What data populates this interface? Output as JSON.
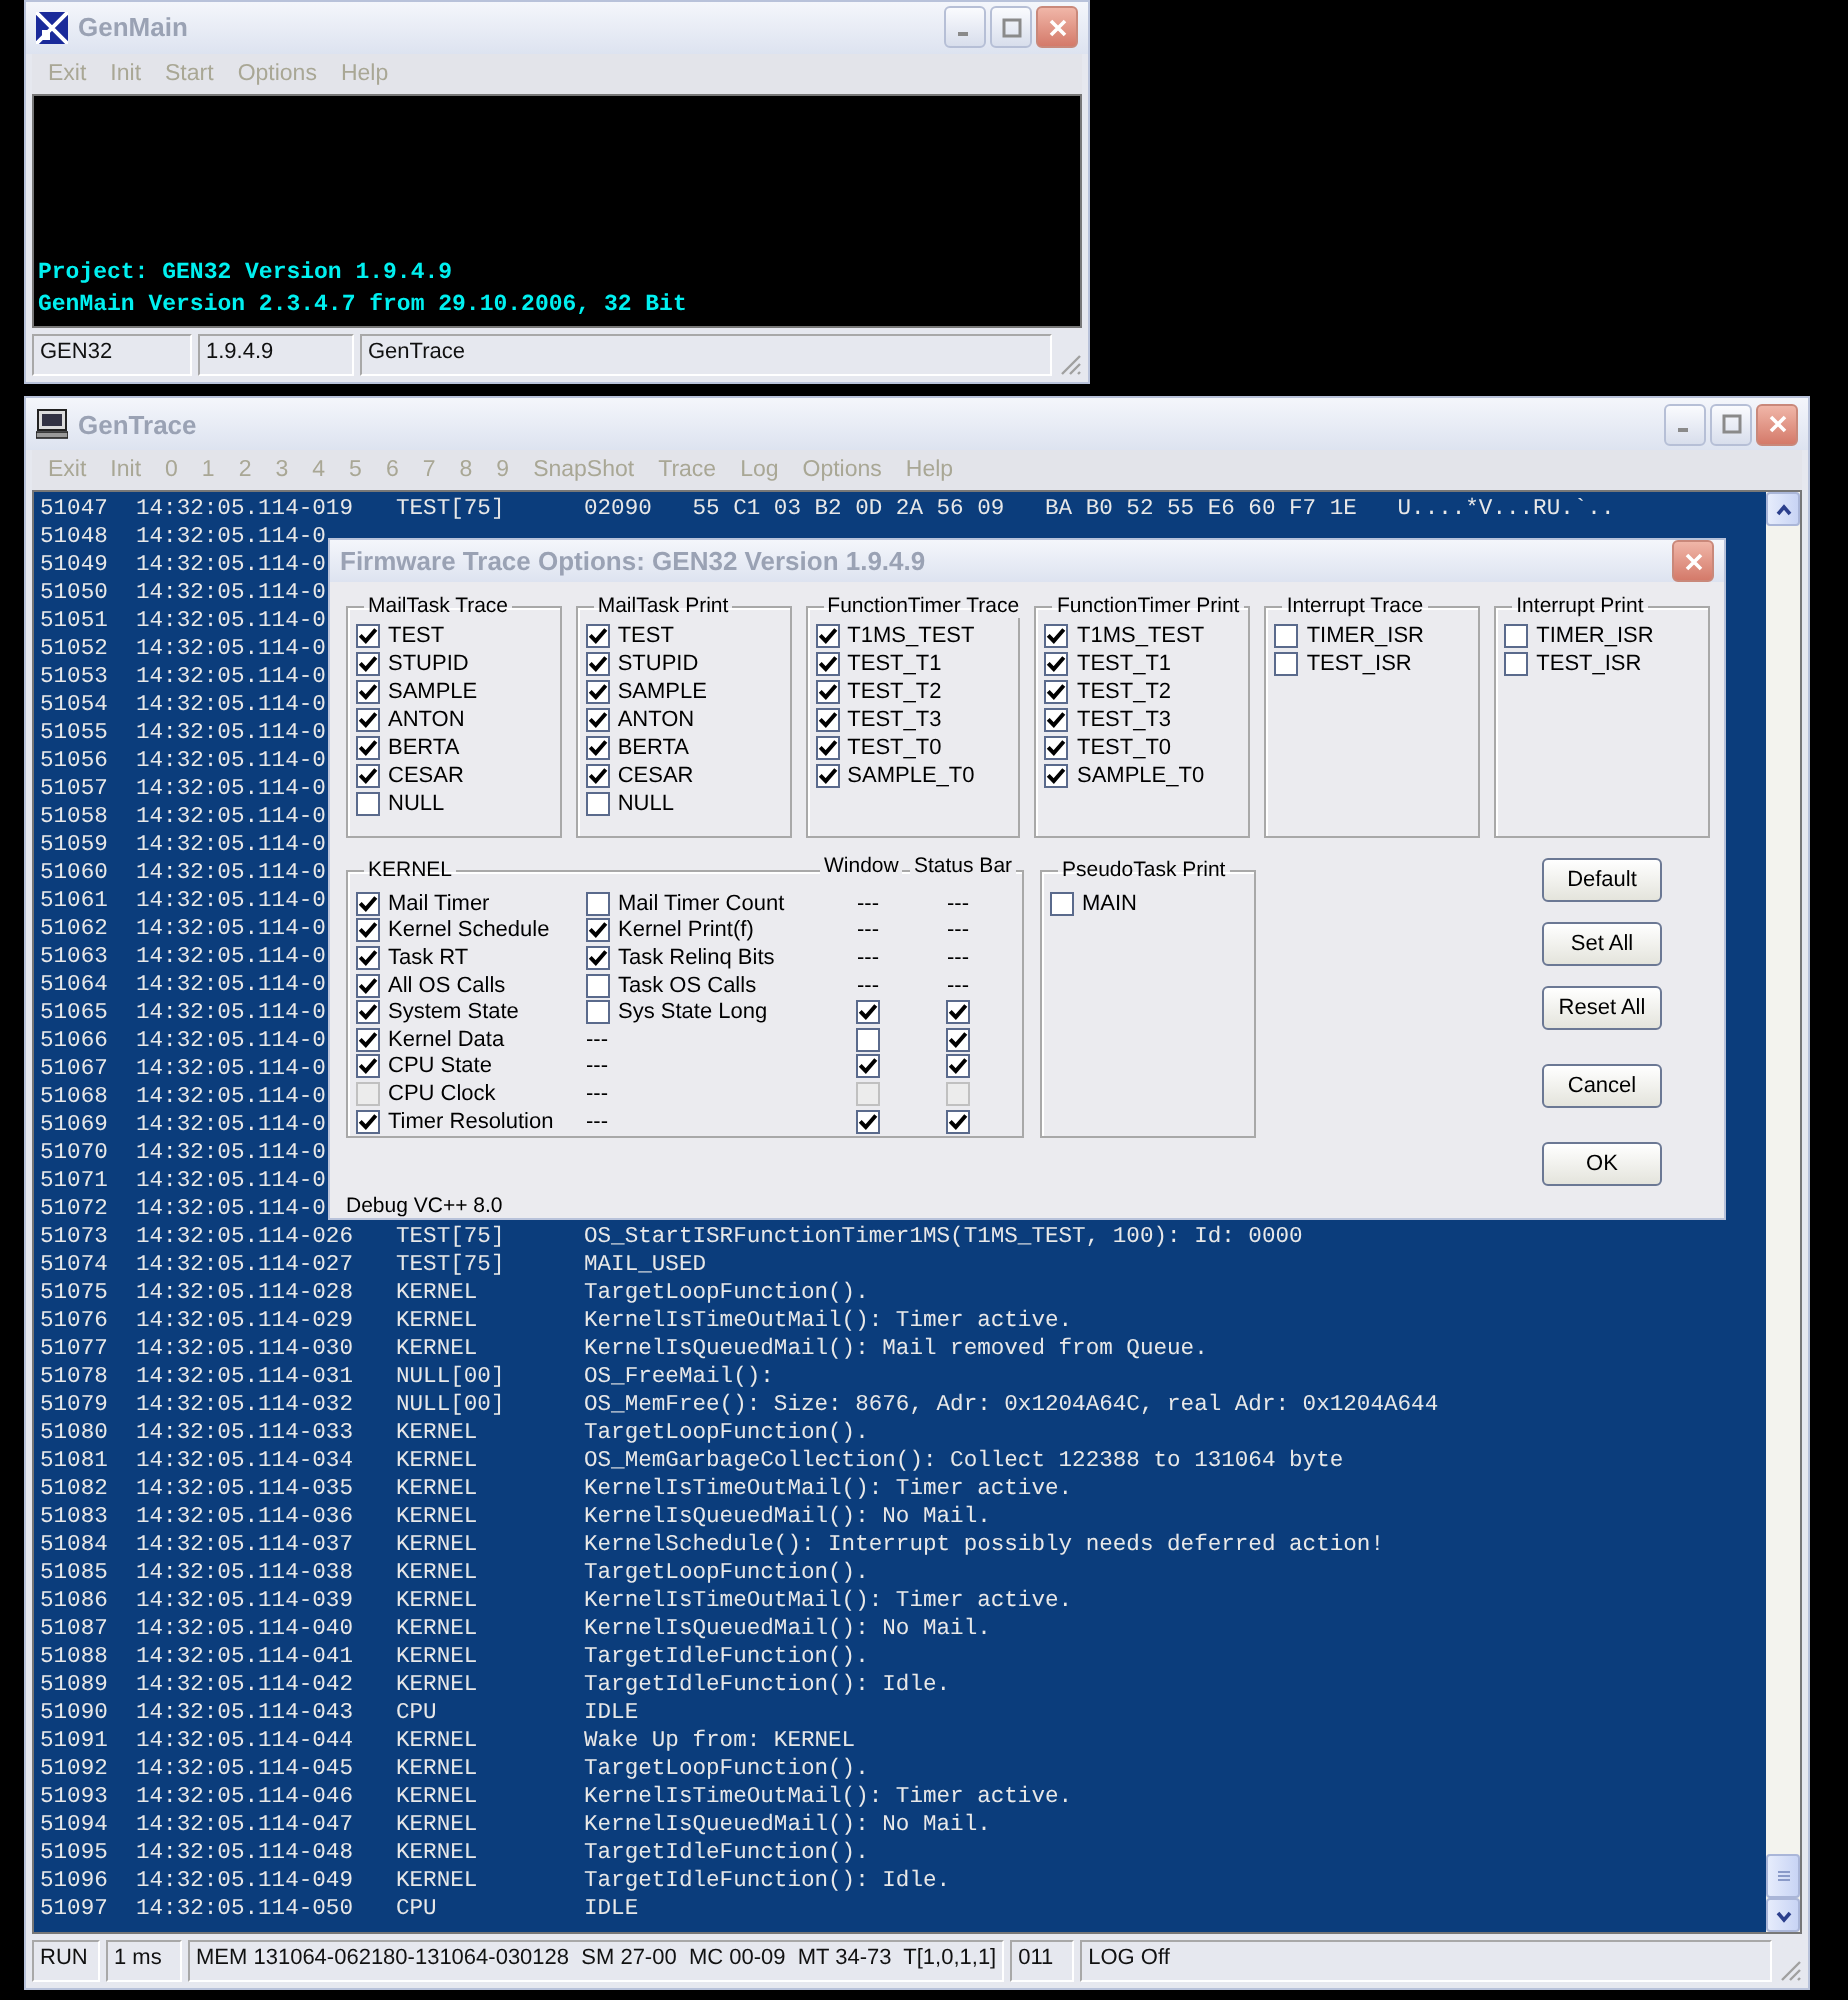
{
  "main_window": {
    "title": "GenMain",
    "menu": [
      "Exit",
      "Init",
      "Start",
      "Options",
      "Help"
    ],
    "console_lines": [
      "Project: GEN32 Version 1.9.4.9",
      "GenMain Version 2.3.4.7 from 29.10.2006, 32 Bit"
    ],
    "status_bar": [
      "GEN32",
      "1.9.4.9",
      "GenTrace"
    ]
  },
  "trace_window": {
    "title": "GenTrace",
    "menu": [
      "Exit",
      "Init",
      "0",
      "1",
      "2",
      "3",
      "4",
      "5",
      "6",
      "7",
      "8",
      "9",
      "SnapShot",
      "Trace",
      "Log",
      "Options",
      "Help"
    ],
    "log_rows": [
      {
        "n": "51047",
        "time": "14:32:05.114-019",
        "source": "TEST[75]",
        "message": "02090   55 C1 03 B2 0D 2A 56 09   BA B0 52 55 E6 60 F7 1E   U....*V...RU.`.."
      },
      {
        "n": "51048",
        "time": "14:32:05.114-0"
      },
      {
        "n": "51049",
        "time": "14:32:05.114-0"
      },
      {
        "n": "51050",
        "time": "14:32:05.114-0"
      },
      {
        "n": "51051",
        "time": "14:32:05.114-0"
      },
      {
        "n": "51052",
        "time": "14:32:05.114-0"
      },
      {
        "n": "51053",
        "time": "14:32:05.114-0"
      },
      {
        "n": "51054",
        "time": "14:32:05.114-0"
      },
      {
        "n": "51055",
        "time": "14:32:05.114-0"
      },
      {
        "n": "51056",
        "time": "14:32:05.114-0"
      },
      {
        "n": "51057",
        "time": "14:32:05.114-0"
      },
      {
        "n": "51058",
        "time": "14:32:05.114-0"
      },
      {
        "n": "51059",
        "time": "14:32:05.114-0"
      },
      {
        "n": "51060",
        "time": "14:32:05.114-0"
      },
      {
        "n": "51061",
        "time": "14:32:05.114-0"
      },
      {
        "n": "51062",
        "time": "14:32:05.114-0"
      },
      {
        "n": "51063",
        "time": "14:32:05.114-0"
      },
      {
        "n": "51064",
        "time": "14:32:05.114-0"
      },
      {
        "n": "51065",
        "time": "14:32:05.114-0"
      },
      {
        "n": "51066",
        "time": "14:32:05.114-0"
      },
      {
        "n": "51067",
        "time": "14:32:05.114-0"
      },
      {
        "n": "51068",
        "time": "14:32:05.114-0"
      },
      {
        "n": "51069",
        "time": "14:32:05.114-0"
      },
      {
        "n": "51070",
        "time": "14:32:05.114-0"
      },
      {
        "n": "51071",
        "time": "14:32:05.114-0"
      },
      {
        "n": "51072",
        "time": "14:32:05.114-0"
      },
      {
        "n": "51073",
        "time": "14:32:05.114-026",
        "source": "TEST[75]",
        "message": "OS_StartISRFunctionTimer1MS(T1MS_TEST, 100): Id: 0000"
      },
      {
        "n": "51074",
        "time": "14:32:05.114-027",
        "source": "TEST[75]",
        "message": "MAIL_USED"
      },
      {
        "n": "51075",
        "time": "14:32:05.114-028",
        "source": "KERNEL",
        "message": "TargetLoopFunction()."
      },
      {
        "n": "51076",
        "time": "14:32:05.114-029",
        "source": "KERNEL",
        "message": "KernelIsTimeOutMail(): Timer active."
      },
      {
        "n": "51077",
        "time": "14:32:05.114-030",
        "source": "KERNEL",
        "message": "KernelIsQueuedMail(): Mail removed from Queue."
      },
      {
        "n": "51078",
        "time": "14:32:05.114-031",
        "source": "NULL[00]",
        "message": "OS_FreeMail():"
      },
      {
        "n": "51079",
        "time": "14:32:05.114-032",
        "source": "NULL[00]",
        "message": "OS_MemFree(): Size: 8676, Adr: 0x1204A64C, real Adr: 0x1204A644"
      },
      {
        "n": "51080",
        "time": "14:32:05.114-033",
        "source": "KERNEL",
        "message": "TargetLoopFunction()."
      },
      {
        "n": "51081",
        "time": "14:32:05.114-034",
        "source": "KERNEL",
        "message": "OS_MemGarbageCollection(): Collect 122388 to 131064 byte"
      },
      {
        "n": "51082",
        "time": "14:32:05.114-035",
        "source": "KERNEL",
        "message": "KernelIsTimeOutMail(): Timer active."
      },
      {
        "n": "51083",
        "time": "14:32:05.114-036",
        "source": "KERNEL",
        "message": "KernelIsQueuedMail(): No Mail."
      },
      {
        "n": "51084",
        "time": "14:32:05.114-037",
        "source": "KERNEL",
        "message": "KernelSchedule(): Interrupt possibly needs deferred action!"
      },
      {
        "n": "51085",
        "time": "14:32:05.114-038",
        "source": "KERNEL",
        "message": "TargetLoopFunction()."
      },
      {
        "n": "51086",
        "time": "14:32:05.114-039",
        "source": "KERNEL",
        "message": "KernelIsTimeOutMail(): Timer active."
      },
      {
        "n": "51087",
        "time": "14:32:05.114-040",
        "source": "KERNEL",
        "message": "KernelIsQueuedMail(): No Mail."
      },
      {
        "n": "51088",
        "time": "14:32:05.114-041",
        "source": "KERNEL",
        "message": "TargetIdleFunction()."
      },
      {
        "n": "51089",
        "time": "14:32:05.114-042",
        "source": "KERNEL",
        "message": "TargetIdleFunction(): Idle."
      },
      {
        "n": "51090",
        "time": "14:32:05.114-043",
        "source": "CPU",
        "message": "IDLE"
      },
      {
        "n": "51091",
        "time": "14:32:05.114-044",
        "source": "KERNEL",
        "message": "Wake Up from: KERNEL"
      },
      {
        "n": "51092",
        "time": "14:32:05.114-045",
        "source": "KERNEL",
        "message": "TargetLoopFunction()."
      },
      {
        "n": "51093",
        "time": "14:32:05.114-046",
        "source": "KERNEL",
        "message": "KernelIsTimeOutMail(): Timer active."
      },
      {
        "n": "51094",
        "time": "14:32:05.114-047",
        "source": "KERNEL",
        "message": "KernelIsQueuedMail(): No Mail."
      },
      {
        "n": "51095",
        "time": "14:32:05.114-048",
        "source": "KERNEL",
        "message": "TargetIdleFunction()."
      },
      {
        "n": "51096",
        "time": "14:32:05.114-049",
        "source": "KERNEL",
        "message": "TargetIdleFunction(): Idle."
      },
      {
        "n": "51097",
        "time": "14:32:05.114-050",
        "source": "CPU",
        "message": "IDLE"
      }
    ],
    "status_bar": [
      "RUN",
      "1 ms",
      "MEM 131064-062180-131064-030128  SM 27-00  MC 00-09  MT 34-73  T[1,0,1,1]",
      "011",
      "LOG Off"
    ]
  },
  "dialog": {
    "title": "Firmware Trace Options: GEN32 Version 1.9.4.9",
    "groups": [
      {
        "title": "MailTask Trace",
        "items": [
          {
            "label": "TEST",
            "checked": true
          },
          {
            "label": "STUPID",
            "checked": true
          },
          {
            "label": "SAMPLE",
            "checked": true
          },
          {
            "label": "ANTON",
            "checked": true
          },
          {
            "label": "BERTA",
            "checked": true
          },
          {
            "label": "CESAR",
            "checked": true
          },
          {
            "label": "NULL",
            "checked": false
          }
        ]
      },
      {
        "title": "MailTask Print",
        "items": [
          {
            "label": "TEST",
            "checked": true
          },
          {
            "label": "STUPID",
            "checked": true
          },
          {
            "label": "SAMPLE",
            "checked": true
          },
          {
            "label": "ANTON",
            "checked": true
          },
          {
            "label": "BERTA",
            "checked": true
          },
          {
            "label": "CESAR",
            "checked": true
          },
          {
            "label": "NULL",
            "checked": false
          }
        ]
      },
      {
        "title": "FunctionTimer Trace",
        "items": [
          {
            "label": "T1MS_TEST",
            "checked": true
          },
          {
            "label": "TEST_T1",
            "checked": true
          },
          {
            "label": "TEST_T2",
            "checked": true
          },
          {
            "label": "TEST_T3",
            "checked": true
          },
          {
            "label": "TEST_T0",
            "checked": true
          },
          {
            "label": "SAMPLE_T0",
            "checked": true
          }
        ]
      },
      {
        "title": "FunctionTimer Print",
        "items": [
          {
            "label": "T1MS_TEST",
            "checked": true
          },
          {
            "label": "TEST_T1",
            "checked": true
          },
          {
            "label": "TEST_T2",
            "checked": true
          },
          {
            "label": "TEST_T3",
            "checked": true
          },
          {
            "label": "TEST_T0",
            "checked": true
          },
          {
            "label": "SAMPLE_T0",
            "checked": true
          }
        ]
      },
      {
        "title": "Interrupt Trace",
        "items": [
          {
            "label": "TIMER_ISR",
            "checked": false
          },
          {
            "label": "TEST_ISR",
            "checked": false
          }
        ]
      },
      {
        "title": "Interrupt Print",
        "items": [
          {
            "label": "TIMER_ISR",
            "checked": false
          },
          {
            "label": "TEST_ISR",
            "checked": false
          }
        ]
      }
    ],
    "kernel": {
      "title": "KERNEL",
      "window_header": "Window",
      "status_header": "Status Bar",
      "rows": [
        {
          "left": {
            "label": "Mail Timer",
            "checked": true,
            "disabled": false
          },
          "right": {
            "kind": "check",
            "label": "Mail Timer Count",
            "checked": false
          },
          "window": {
            "kind": "dash",
            "text": "---"
          },
          "status": {
            "kind": "dash",
            "text": "---"
          }
        },
        {
          "left": {
            "label": "Kernel Schedule",
            "checked": true,
            "disabled": false
          },
          "right": {
            "kind": "check",
            "label": "Kernel Print(f)",
            "checked": true
          },
          "window": {
            "kind": "dash",
            "text": "---"
          },
          "status": {
            "kind": "dash",
            "text": "---"
          }
        },
        {
          "left": {
            "label": "Task RT",
            "checked": true,
            "disabled": false
          },
          "right": {
            "kind": "check",
            "label": "Task Relinq Bits",
            "checked": true
          },
          "window": {
            "kind": "dash",
            "text": "---"
          },
          "status": {
            "kind": "dash",
            "text": "---"
          }
        },
        {
          "left": {
            "label": "All OS Calls",
            "checked": true,
            "disabled": false
          },
          "right": {
            "kind": "check",
            "label": "Task OS Calls",
            "checked": false
          },
          "window": {
            "kind": "dash",
            "text": "---"
          },
          "status": {
            "kind": "dash",
            "text": "---"
          }
        },
        {
          "left": {
            "label": "System State",
            "checked": true,
            "disabled": false
          },
          "right": {
            "kind": "check",
            "label": "Sys State Long",
            "checked": false
          },
          "window": {
            "kind": "check",
            "checked": true,
            "disabled": false
          },
          "status": {
            "kind": "check",
            "checked": true,
            "disabled": false
          }
        },
        {
          "left": {
            "label": "Kernel Data",
            "checked": true,
            "disabled": false
          },
          "right": {
            "kind": "dash",
            "text": "---"
          },
          "window": {
            "kind": "check",
            "checked": false,
            "disabled": false
          },
          "status": {
            "kind": "check",
            "checked": true,
            "disabled": false
          }
        },
        {
          "left": {
            "label": "CPU State",
            "checked": true,
            "disabled": false
          },
          "right": {
            "kind": "dash",
            "text": "---"
          },
          "window": {
            "kind": "check",
            "checked": true,
            "disabled": false
          },
          "status": {
            "kind": "check",
            "checked": true,
            "disabled": false
          }
        },
        {
          "left": {
            "label": "CPU Clock",
            "checked": false,
            "disabled": true
          },
          "right": {
            "kind": "dash",
            "text": "---"
          },
          "window": {
            "kind": "check",
            "checked": false,
            "disabled": true
          },
          "status": {
            "kind": "check",
            "checked": false,
            "disabled": true
          }
        },
        {
          "left": {
            "label": "Timer Resolution",
            "checked": true,
            "disabled": false
          },
          "right": {
            "kind": "dash",
            "text": "---"
          },
          "window": {
            "kind": "check",
            "checked": true,
            "disabled": false
          },
          "status": {
            "kind": "check",
            "checked": true,
            "disabled": false
          }
        }
      ]
    },
    "pseudo": {
      "title": "PseudoTask Print",
      "items": [
        {
          "label": "MAIN",
          "checked": false
        }
      ]
    },
    "buttons": [
      "Default",
      "Set All",
      "Reset All",
      "Cancel",
      "OK"
    ],
    "footer": "Debug VC++ 8.0"
  }
}
